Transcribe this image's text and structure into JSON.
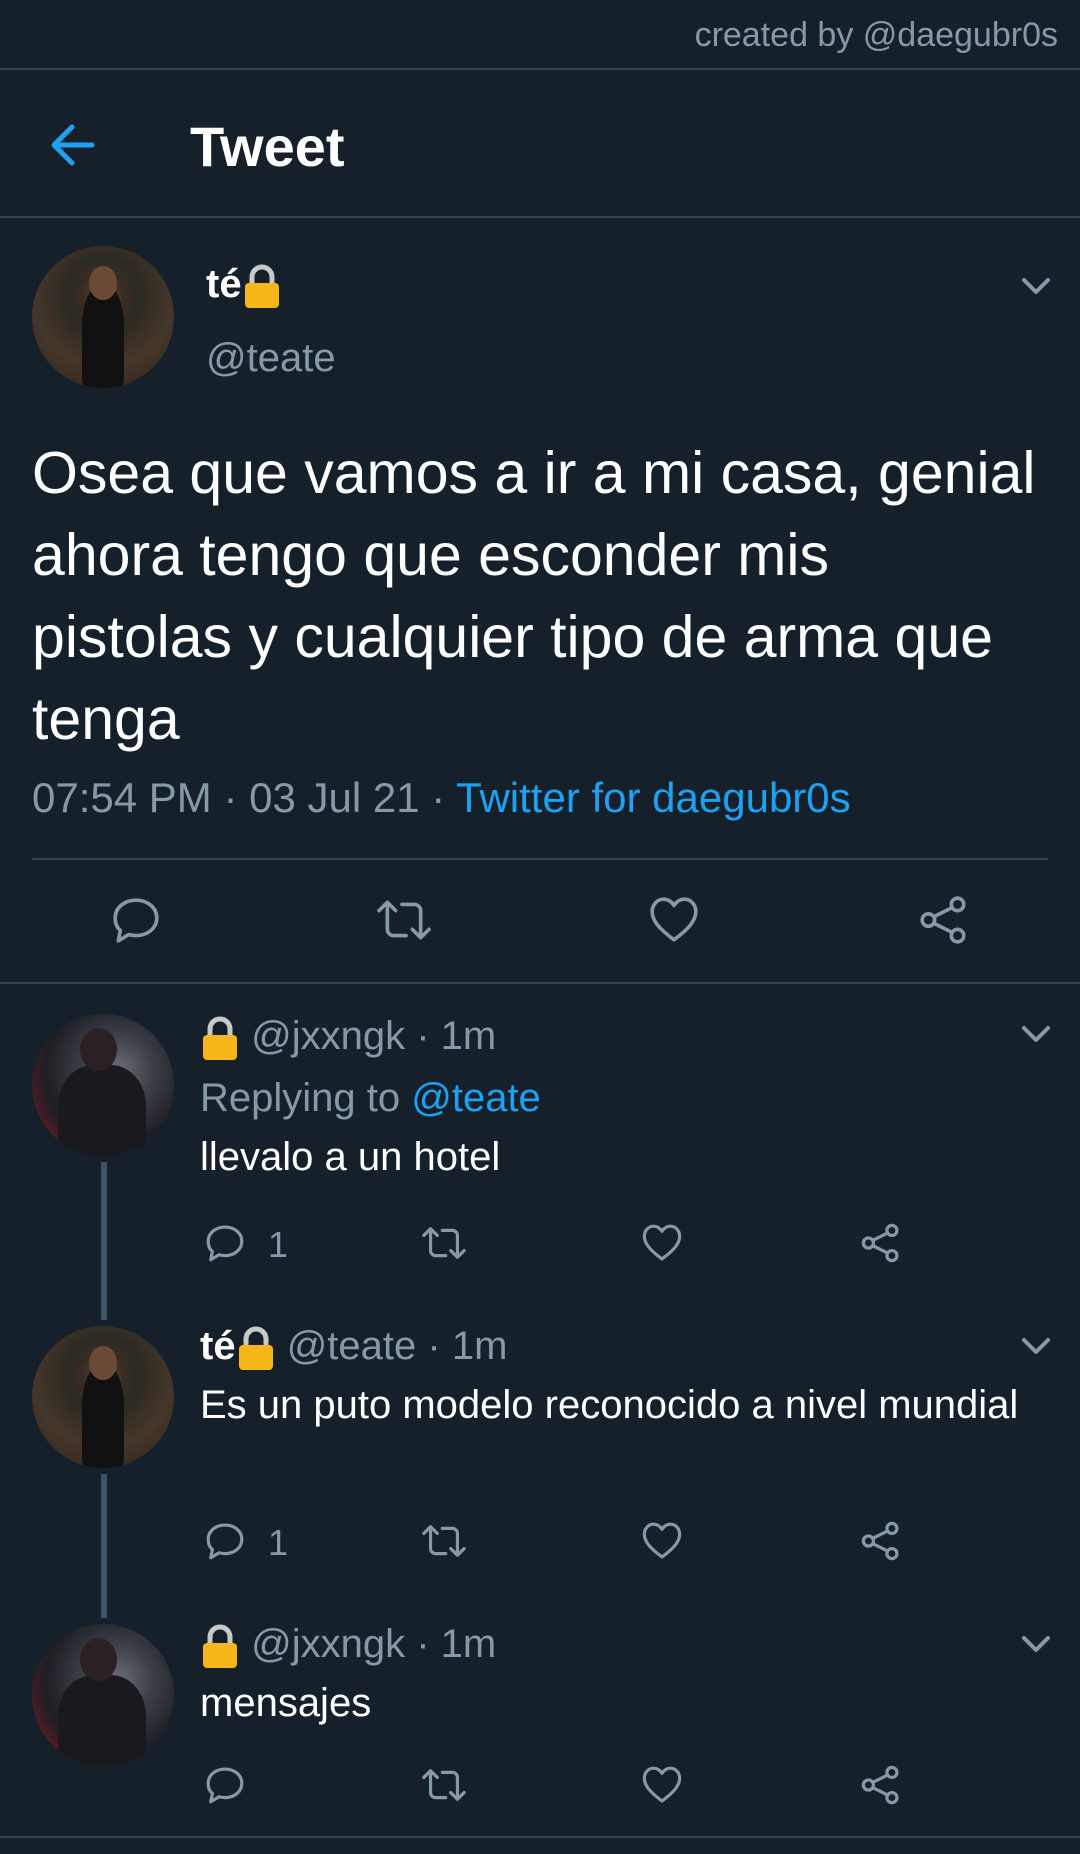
{
  "credit": "created by @daegubr0s",
  "header": {
    "title": "Tweet"
  },
  "main_tweet": {
    "name": "té",
    "handle": "@teate",
    "text": "Osea que vamos a ir a mi casa, genial ahora tengo que esconder mis pistolas y cualquier tipo de arma que tenga",
    "time": "07:54 PM · 03 Jul 21 · ",
    "source": "Twitter for daegubr0s"
  },
  "replies": [
    {
      "handle": "@jxxngk · 1m",
      "replying_prefix": "Replying to ",
      "replying_to": "@teate",
      "text": "llevalo a un hotel",
      "reply_count": "1"
    },
    {
      "name": "té",
      "handle": "@teate · 1m",
      "text": "Es un puto modelo reconocido a nivel mundial",
      "reply_count": "1"
    },
    {
      "handle": "@jxxngk · 1m",
      "text": "mensajes"
    }
  ],
  "colors": {
    "background": "#15202b",
    "accent": "#1da1f2",
    "secondary_text": "#8899a6",
    "divider": "#38444d",
    "thread_line": "#3d5466"
  },
  "icons": [
    "back-arrow-icon",
    "lock-icon",
    "chevron-down-icon",
    "reply-icon",
    "retweet-icon",
    "like-icon",
    "share-icon"
  ]
}
